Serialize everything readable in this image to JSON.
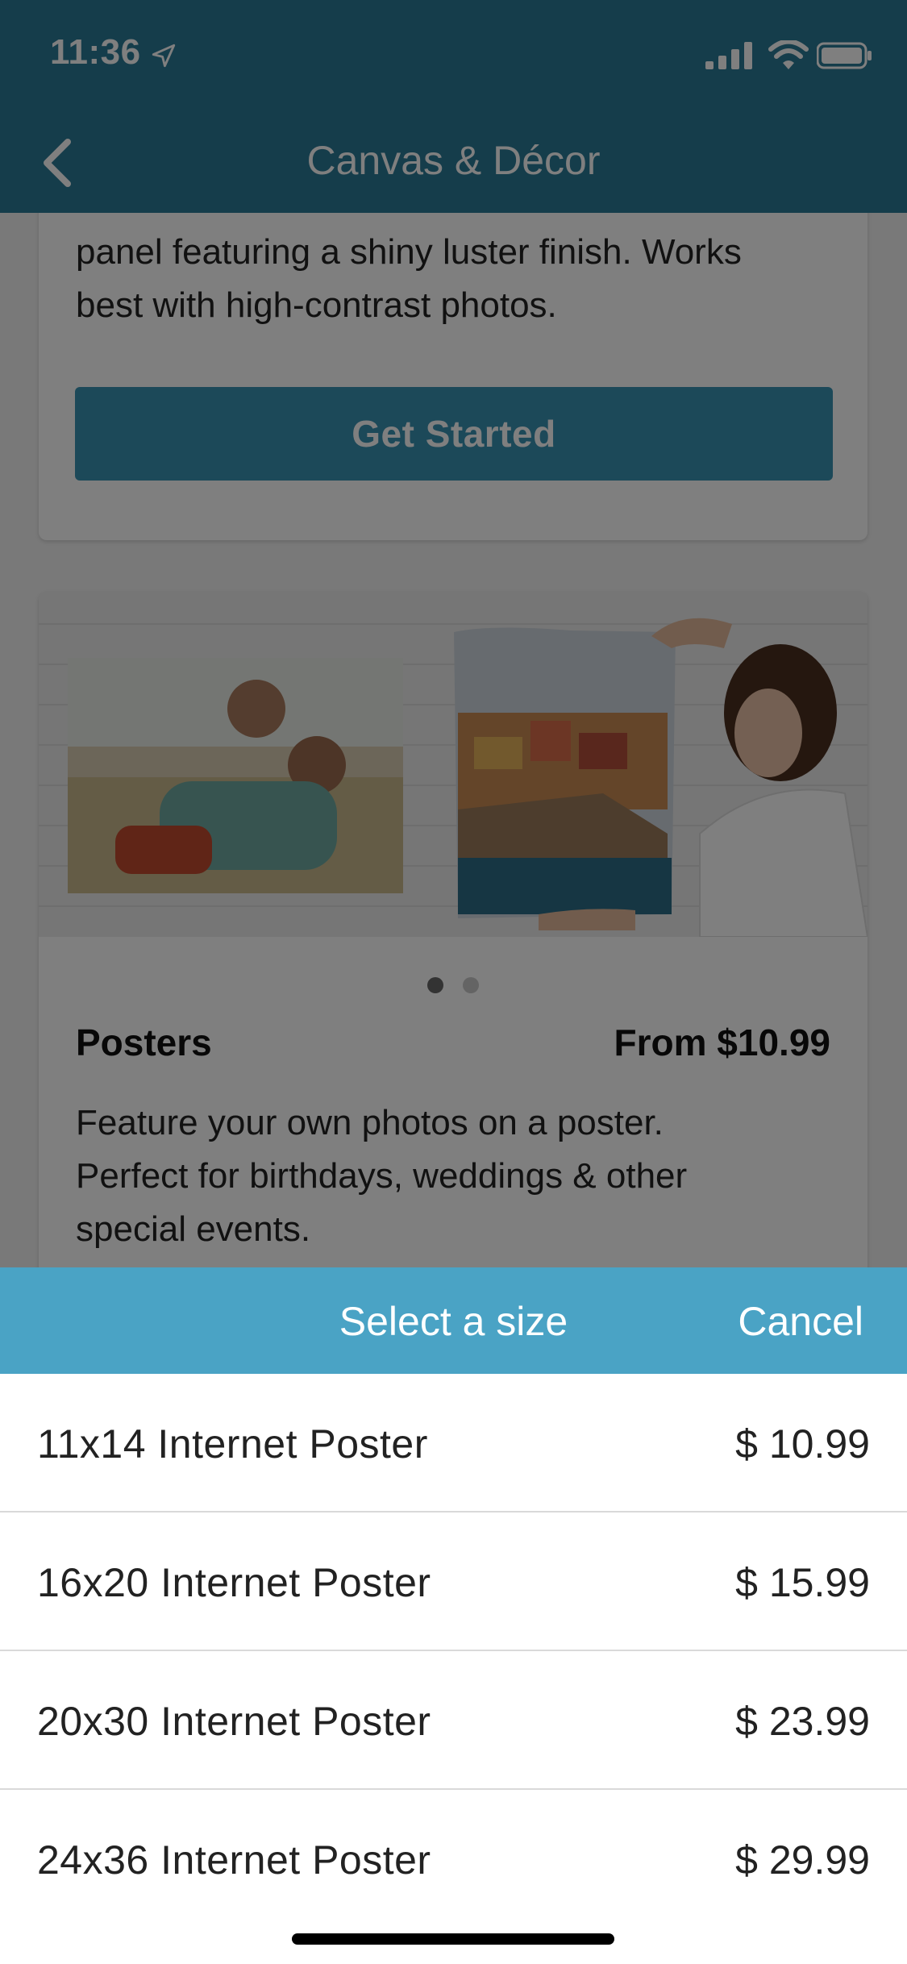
{
  "status_bar": {
    "time": "11:36"
  },
  "nav": {
    "title": "Canvas & Décor"
  },
  "card1": {
    "description_lines": [
      "panel featuring a shiny luster finish. Works",
      "best with high-contrast photos."
    ],
    "button_label": "Get Started"
  },
  "card2": {
    "title": "Posters",
    "price": "From $10.99",
    "description_lines": [
      "Feature your own photos on a poster.",
      "Perfect for birthdays, weddings & other",
      "special events."
    ],
    "carousel": {
      "active_index": 0,
      "count": 2
    }
  },
  "sheet": {
    "title": "Select a size",
    "cancel_label": "Cancel",
    "options": [
      {
        "name": "11x14 Internet Poster",
        "price": "$ 10.99"
      },
      {
        "name": "16x20 Internet Poster",
        "price": "$ 15.99"
      },
      {
        "name": "20x30 Internet Poster",
        "price": "$ 23.99"
      },
      {
        "name": "24x36 Internet Poster",
        "price": "$ 29.99"
      }
    ]
  },
  "colors": {
    "header": "#2b7b96",
    "button": "#3892b3",
    "sheet_header": "#4aa3c5"
  },
  "icons": [
    "location-arrow-icon",
    "signal-icon",
    "wifi-icon",
    "battery-icon",
    "back-chevron-icon"
  ]
}
